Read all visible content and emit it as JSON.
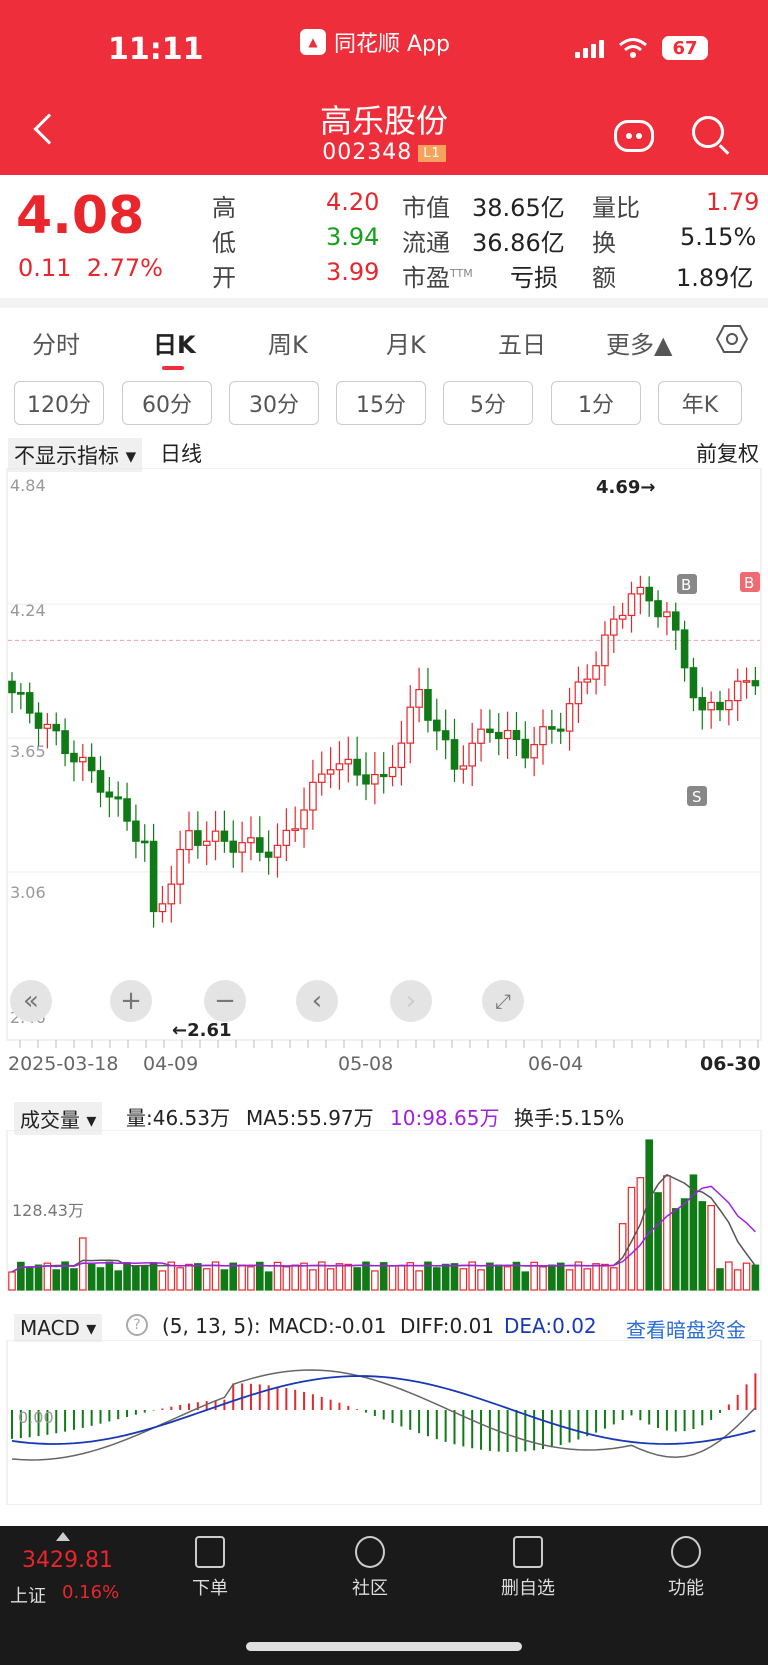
{
  "status": {
    "time": "11:11",
    "app": "同花顺 App",
    "battery": "67"
  },
  "header": {
    "name": "高乐股份",
    "code": "002348",
    "badge": "L1"
  },
  "quote": {
    "price": "4.08",
    "change": "0.11",
    "change_pct": "2.77%",
    "high_l": "高",
    "high": "4.20",
    "low_l": "低",
    "low": "3.94",
    "open_l": "开",
    "open": "3.99",
    "mcap_l": "市值",
    "mcap": "38.65亿",
    "float_l": "流通",
    "float": "36.86亿",
    "pe_l": "市盈",
    "pe_sup": "TTM",
    "pe": "亏损",
    "vr_l": "量比",
    "vr": "1.79",
    "turn_l": "换",
    "turn": "5.15%",
    "amt_l": "额",
    "amt": "1.89亿"
  },
  "tabs": [
    "分时",
    "日K",
    "周K",
    "月K",
    "五日",
    "更多▲"
  ],
  "periods": [
    "120分",
    "60分",
    "30分",
    "15分",
    "5分",
    "1分",
    "年K"
  ],
  "kline": {
    "indicator": "不显示指标 ▾",
    "line": "日线",
    "adjust": "前复权",
    "yticks": [
      "4.84",
      "4.24",
      "3.65",
      "3.06",
      "2.46"
    ],
    "high_label": "4.69→",
    "low_label": "←2.61",
    "dates": [
      "2025-03-18",
      "04-09",
      "05-08",
      "06-04",
      "06-30"
    ],
    "marker_b": "B",
    "marker_s": "S"
  },
  "volume": {
    "selector": "成交量 ▾",
    "vol": "量:46.53万",
    "ma5": "MA5:55.97万",
    "ma10": "10:98.65万",
    "turn": "换手:5.15%",
    "ytick": "128.43万"
  },
  "macd": {
    "selector": "MACD ▾",
    "params": "(5, 13, 5):",
    "macd": "MACD:-0.01",
    "diff": "DIFF:0.01",
    "dea": "DEA:0.02",
    "link": "查看暗盘资金",
    "zero": "0.00"
  },
  "bottom": {
    "index_value": "3429.81",
    "index_name": "上证",
    "index_pct": "0.16%",
    "order": "下单",
    "community": "社区",
    "watch": "删自选",
    "func": "功能"
  },
  "colors": {
    "up": "#e8262c",
    "down": "#0f7a16",
    "header": "#ee2f3b"
  }
}
